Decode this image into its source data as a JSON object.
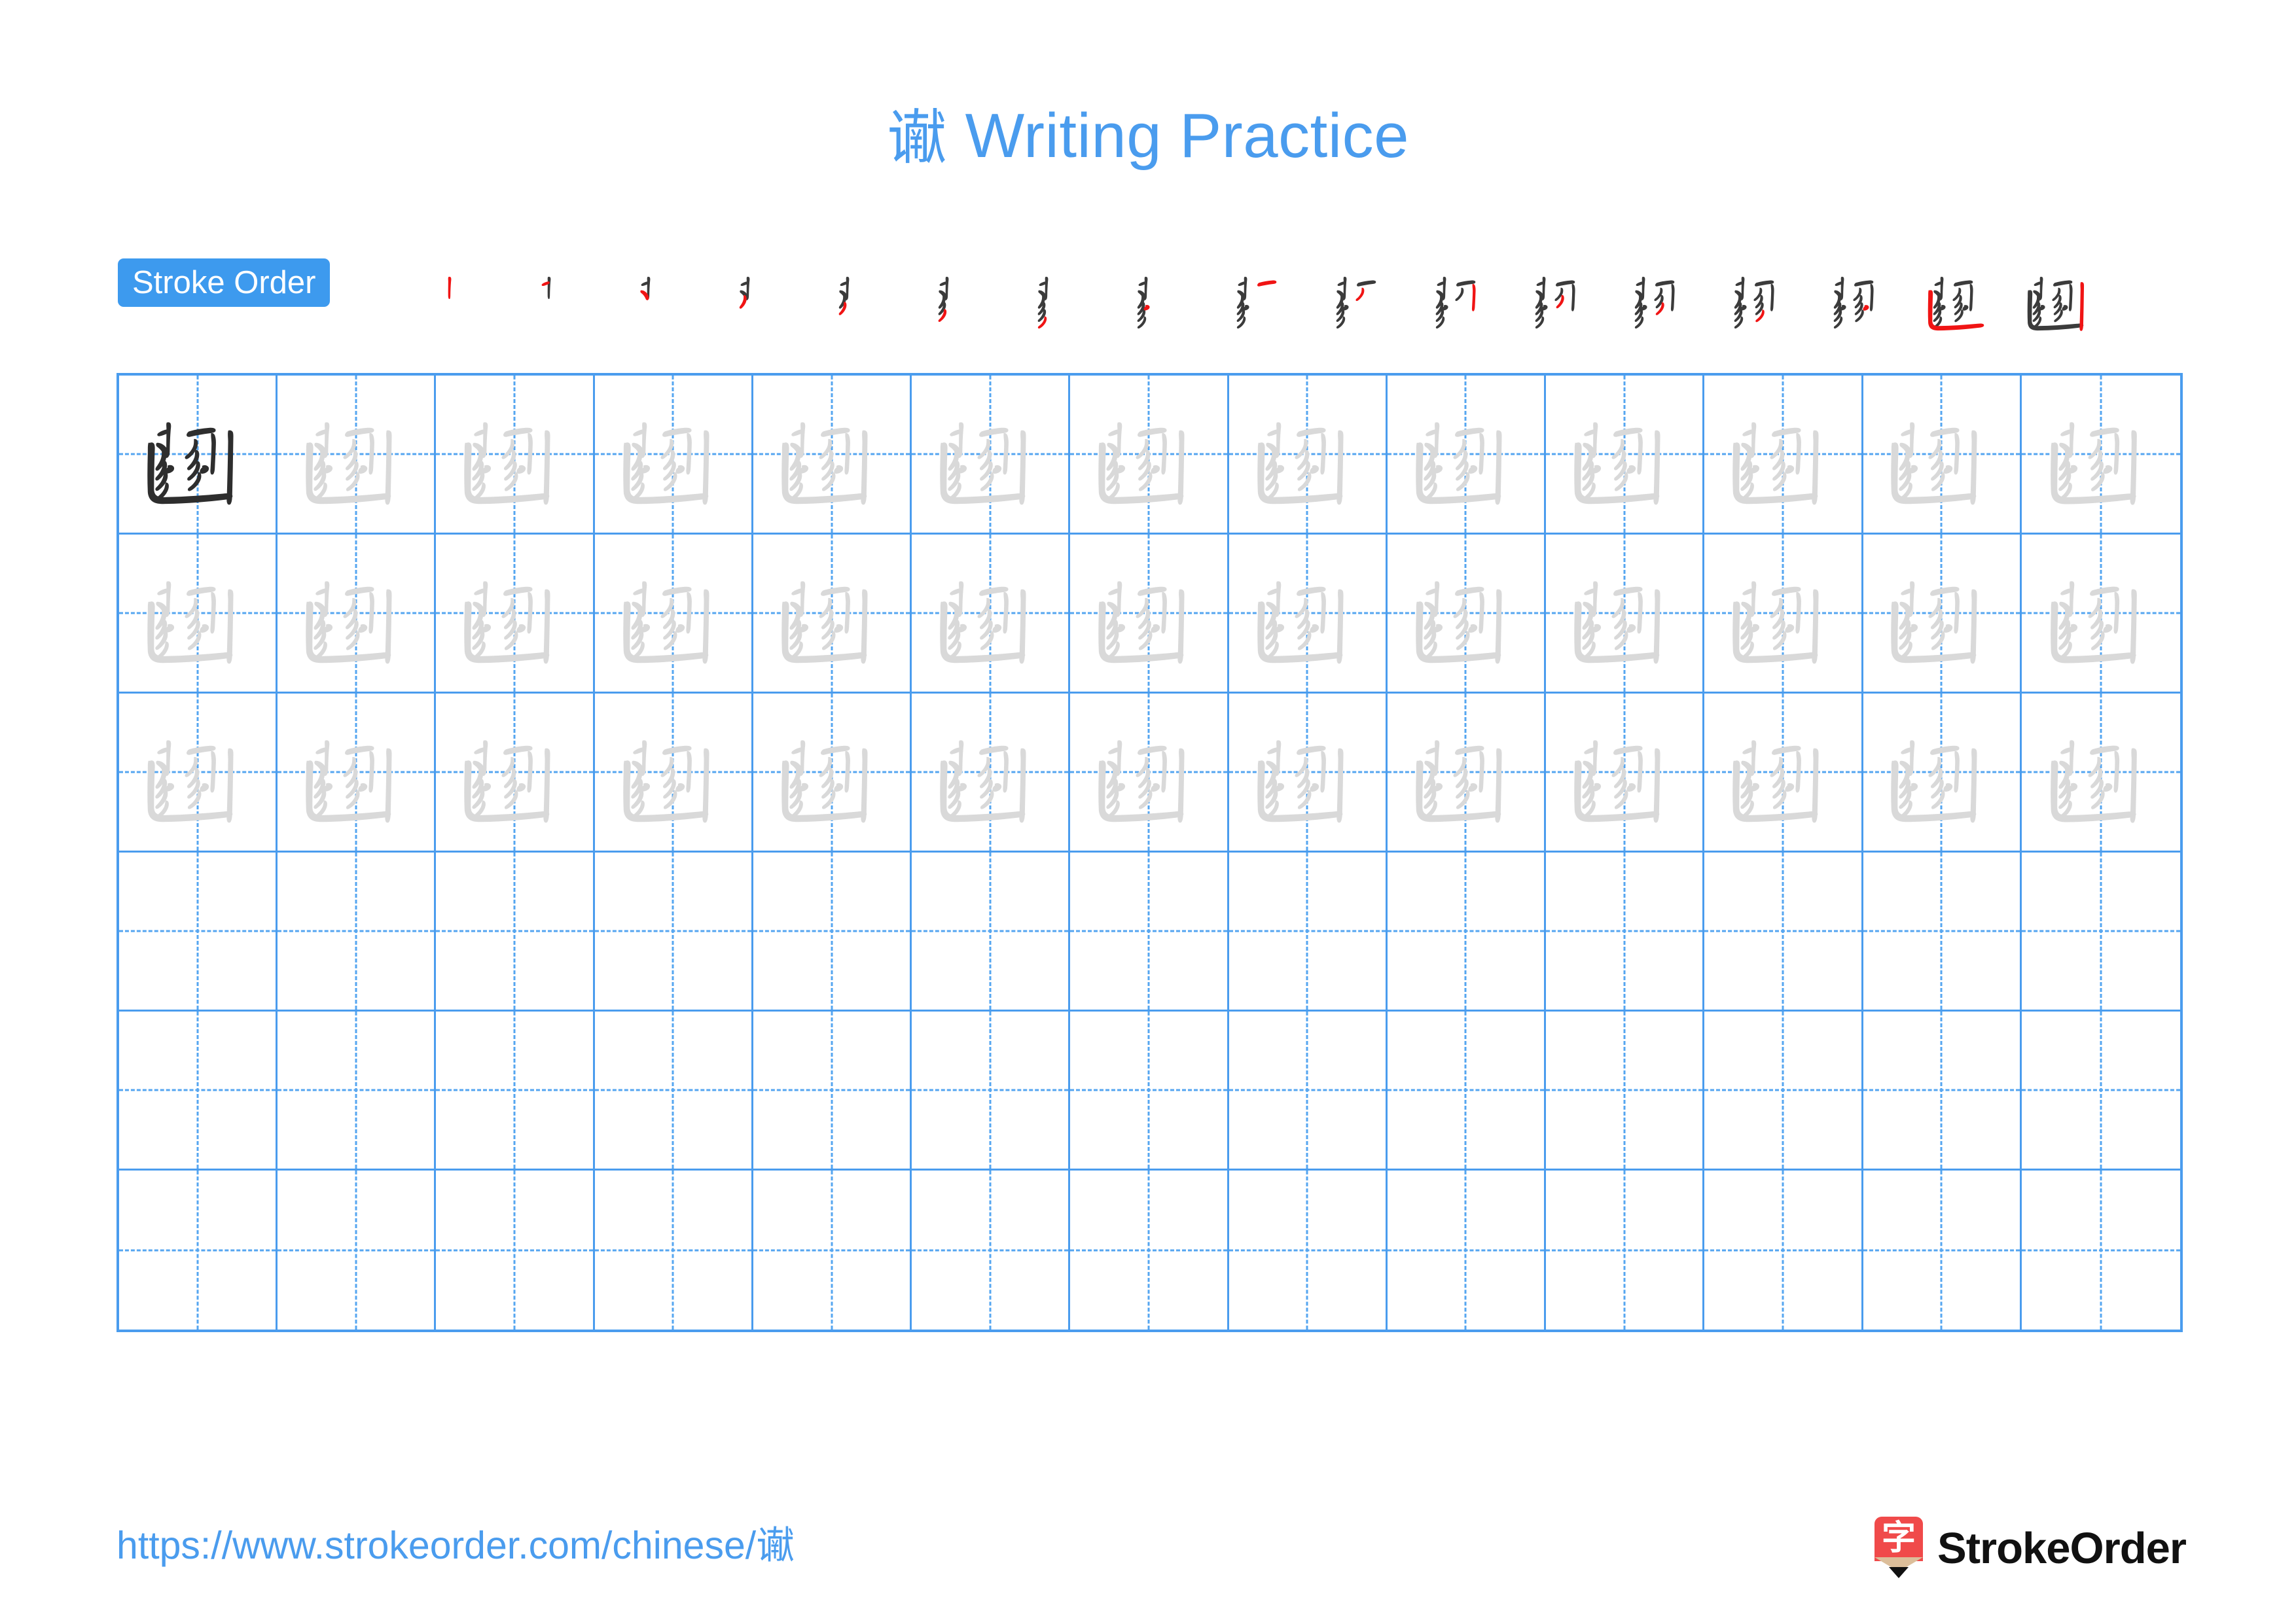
{
  "page": {
    "character": "谳",
    "background_color": "#ffffff",
    "accent_color": "#4A9CEE",
    "stroke_done_color": "#3B3B3B",
    "stroke_new_color": "#F01414",
    "trace_color": "#D9D9D9",
    "solid_color": "#2E2E2E"
  },
  "title": {
    "character": "谳",
    "text": " Writing Practice",
    "full": "谳 Writing Practice"
  },
  "stroke_order": {
    "badge_label": "Stroke Order",
    "total_steps": 17,
    "steps": [
      {
        "index": 1,
        "new_stroke": "竖 (vertical)"
      },
      {
        "index": 2,
        "new_stroke": "撇 (left-falling)"
      },
      {
        "index": 3,
        "new_stroke": "弯钩 (bend hook)"
      },
      {
        "index": 4,
        "new_stroke": "撇 (left-falling)"
      },
      {
        "index": 5,
        "new_stroke": "撇 (left-falling)"
      },
      {
        "index": 6,
        "new_stroke": "撇 (left-falling)"
      },
      {
        "index": 7,
        "new_stroke": "撇 (left-falling)"
      },
      {
        "index": 8,
        "new_stroke": "捕 (short stroke)"
      },
      {
        "index": 9,
        "new_stroke": "横 (horizontal)"
      },
      {
        "index": 10,
        "new_stroke": "撇 (left-falling)"
      },
      {
        "index": 11,
        "new_stroke": "弯钩 (bend hook)"
      },
      {
        "index": 12,
        "new_stroke": "撇 (left-falling)"
      },
      {
        "index": 13,
        "new_stroke": "撇 (left-falling)"
      },
      {
        "index": 14,
        "new_stroke": "撇 (left-falling)"
      },
      {
        "index": 15,
        "new_stroke": "捕 (short stroke)"
      },
      {
        "index": 16,
        "new_stroke": "竖折 (vertical turn)"
      },
      {
        "index": 17,
        "new_stroke": "竖 (right vertical)"
      }
    ]
  },
  "grid": {
    "columns": 13,
    "rows": 6,
    "filled_rows": 3,
    "empty_rows": 3,
    "first_cell_mode": "solid",
    "trace_mode": "trace",
    "cells": [
      [
        "solid",
        "trace",
        "trace",
        "trace",
        "trace",
        "trace",
        "trace",
        "trace",
        "trace",
        "trace",
        "trace",
        "trace",
        "trace"
      ],
      [
        "trace",
        "trace",
        "trace",
        "trace",
        "trace",
        "trace",
        "trace",
        "trace",
        "trace",
        "trace",
        "trace",
        "trace",
        "trace"
      ],
      [
        "trace",
        "trace",
        "trace",
        "trace",
        "trace",
        "trace",
        "trace",
        "trace",
        "trace",
        "trace",
        "trace",
        "trace",
        "trace"
      ],
      [
        "empty",
        "empty",
        "empty",
        "empty",
        "empty",
        "empty",
        "empty",
        "empty",
        "empty",
        "empty",
        "empty",
        "empty",
        "empty"
      ],
      [
        "empty",
        "empty",
        "empty",
        "empty",
        "empty",
        "empty",
        "empty",
        "empty",
        "empty",
        "empty",
        "empty",
        "empty",
        "empty"
      ],
      [
        "empty",
        "empty",
        "empty",
        "empty",
        "empty",
        "empty",
        "empty",
        "empty",
        "empty",
        "empty",
        "empty",
        "empty",
        "empty"
      ]
    ]
  },
  "footer": {
    "url_prefix": "https://www.strokeorder.com/chinese/",
    "url_character": "谳",
    "url_full": "https://www.strokeorder.com/chinese/谳",
    "brand_name": "StrokeOrder",
    "brand_mark_character": "字"
  }
}
